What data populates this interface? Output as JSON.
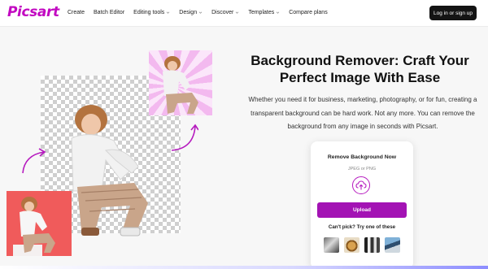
{
  "brand": {
    "logo": "Picsart",
    "accent": "#c209c1",
    "button_purple": "#a313b4"
  },
  "nav": {
    "items": [
      {
        "label": "Create",
        "dropdown": false
      },
      {
        "label": "Batch Editor",
        "dropdown": false
      },
      {
        "label": "Editing tools",
        "dropdown": true
      },
      {
        "label": "Design",
        "dropdown": true
      },
      {
        "label": "Discover",
        "dropdown": true
      },
      {
        "label": "Templates",
        "dropdown": true
      },
      {
        "label": "Compare plans",
        "dropdown": false
      }
    ],
    "login": "Log in or sign up"
  },
  "hero": {
    "headline": "Background Remover: Craft Your Perfect Image With Ease",
    "description": "Whether you need it for business, marketing, photography, or for fun, creating a transparent background can be hard work. Not any more. You can remove the background from any image in seconds with Picsart."
  },
  "card": {
    "title": "Remove Background Now",
    "subtitle": "JPEG or PNG",
    "upload_label": "Upload",
    "hint": "Can't pick? Try one of these",
    "thumbnails": [
      "sample-photo-room",
      "sample-photo-dog",
      "sample-photo-people",
      "sample-photo-sport"
    ]
  },
  "icons": [
    "chevron-down-icon",
    "upload-cloud-icon",
    "curved-arrow-icon"
  ]
}
